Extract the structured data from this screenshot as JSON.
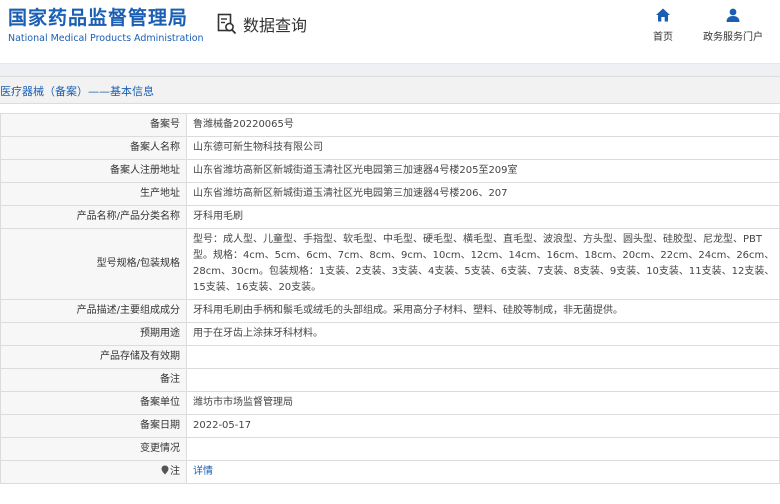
{
  "header": {
    "brand_cn": "国家药品监督管理局",
    "brand_en": "National Medical Products Administration",
    "query_label": "数据查询",
    "query_icon": "search-document-icon",
    "nav": [
      {
        "label": "首页",
        "icon": "home-icon"
      },
      {
        "label": "政务服务门户",
        "icon": "person-icon"
      }
    ]
  },
  "breadcrumb": "医疗器械（备案）——基本信息",
  "colors": {
    "brand": "#1a5fb4",
    "label_bg": "#f7f7f7",
    "border": "#dcdcdc"
  },
  "rows": [
    {
      "label": "备案号",
      "value": "鲁潍械备20220065号"
    },
    {
      "label": "备案人名称",
      "value": "山东德可新生物科技有限公司"
    },
    {
      "label": "备案人注册地址",
      "value": "山东省潍坊高新区新城街道玉清社区光电园第三加速器4号楼205至209室"
    },
    {
      "label": "生产地址",
      "value": "山东省潍坊高新区新城街道玉清社区光电园第三加速器4号楼206、207"
    },
    {
      "label": "产品名称/产品分类名称",
      "value": "牙科用毛刷"
    },
    {
      "label": "型号规格/包装规格",
      "value": "型号：成人型、儿童型、手指型、软毛型、中毛型、硬毛型、横毛型、直毛型、波浪型、方头型、圆头型、硅胶型、尼龙型、PBT型。规格：4cm、5cm、6cm、7cm、8cm、9cm、10cm、12cm、14cm、16cm、18cm、20cm、22cm、24cm、26cm、28cm、30cm。包装规格：1支装、2支装、3支装、4支装、5支装、6支装、7支装、8支装、9支装、10支装、11支装、12支装、15支装、16支装、20支装。"
    },
    {
      "label": "产品描述/主要组成成分",
      "value": "牙科用毛刷由手柄和鬃毛或绒毛的头部组成。采用高分子材料、塑料、硅胶等制成，非无菌提供。"
    },
    {
      "label": "预期用途",
      "value": "用于在牙齿上涂抹牙科材料。"
    },
    {
      "label": "产品存储及有效期",
      "value": ""
    },
    {
      "label": "备注",
      "value": ""
    },
    {
      "label": "备案单位",
      "value": "潍坊市市场监督管理局"
    },
    {
      "label": "备案日期",
      "value": "2022-05-17"
    },
    {
      "label": "变更情况",
      "value": ""
    },
    {
      "label": "注",
      "value": "详情",
      "icon": "pin-icon"
    }
  ]
}
